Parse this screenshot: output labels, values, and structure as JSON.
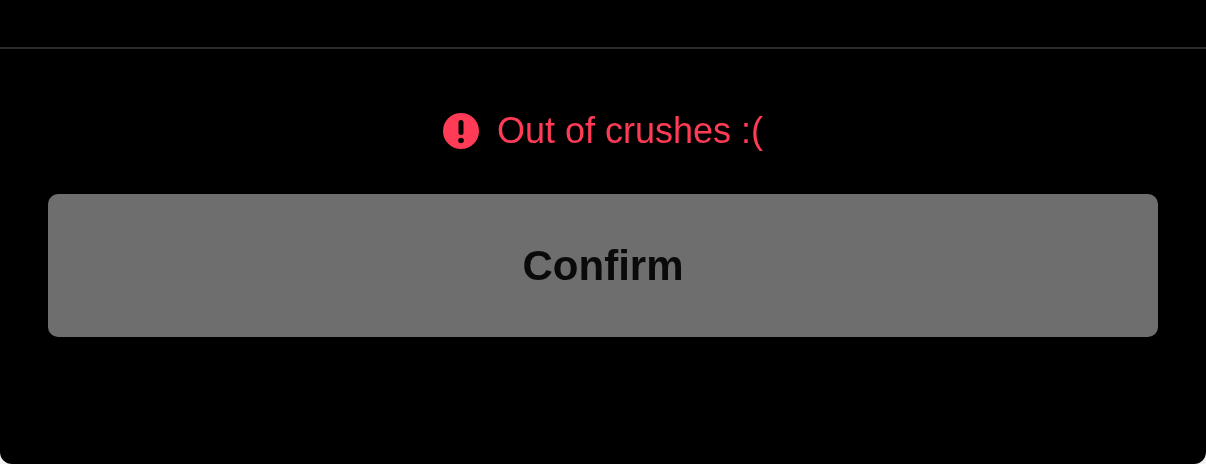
{
  "error": {
    "message": "Out of crushes :("
  },
  "confirm_button": {
    "label": "Confirm",
    "disabled": true
  }
}
